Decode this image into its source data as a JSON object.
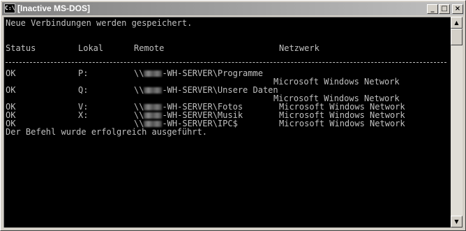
{
  "window": {
    "title": "[Inactive MS-DOS]",
    "icon_label": "C:\\",
    "buttons": {
      "minimize": "_",
      "maximize": "□",
      "close": "×"
    }
  },
  "console": {
    "line_saved": "Neue Verbindungen werden gespeichert.",
    "headers": {
      "status": "Status",
      "local": "Lokal",
      "remote": "Remote",
      "network": "Netzwerk"
    },
    "rows": [
      {
        "status": "OK",
        "local": "P:",
        "prefix": "\\\\",
        "remote_rest": "-WH-SERVER\\Programme",
        "network": "Microsoft Windows Network",
        "network_wrapped": true
      },
      {
        "status": "OK",
        "local": "Q:",
        "prefix": "\\\\",
        "remote_rest": "-WH-SERVER\\Unsere Daten",
        "network": "Microsoft Windows Network",
        "network_wrapped": true
      },
      {
        "status": "OK",
        "local": "V:",
        "prefix": "\\\\",
        "remote_rest": "-WH-SERVER\\Fotos",
        "network": "Microsoft Windows Network",
        "network_wrapped": false
      },
      {
        "status": "OK",
        "local": "X:",
        "prefix": "\\\\",
        "remote_rest": "-WH-SERVER\\Musik",
        "network": "Microsoft Windows Network",
        "network_wrapped": false
      },
      {
        "status": "OK",
        "local": "",
        "prefix": "\\\\",
        "remote_rest": "-WH-SERVER\\IPC$",
        "network": "Microsoft Windows Network",
        "network_wrapped": false
      }
    ],
    "line_success": "Der Befehl wurde erfolgreich ausgeführt."
  },
  "scrollbar": {
    "up_arrow": "▲",
    "down_arrow": "▼"
  }
}
